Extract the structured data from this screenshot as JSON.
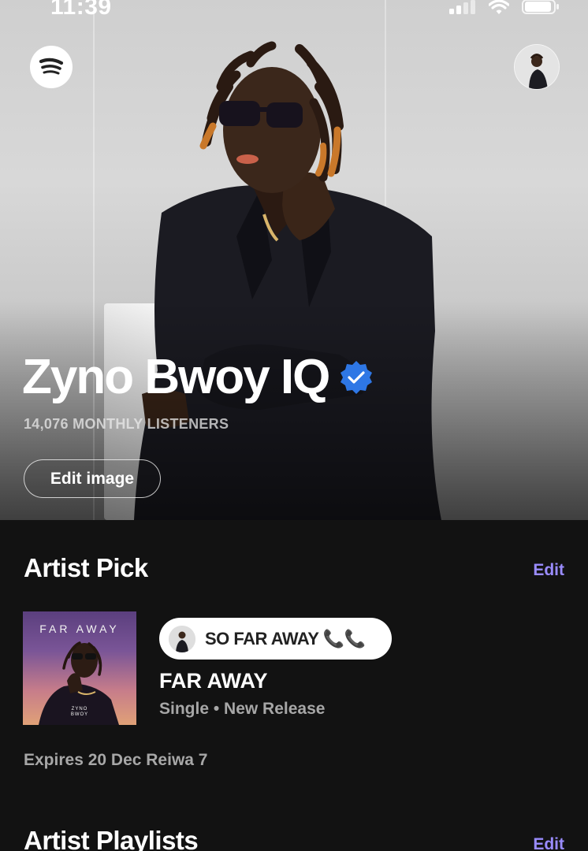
{
  "status_bar": {
    "time": "11:39",
    "icons": [
      "signal-icon",
      "wifi-icon",
      "battery-icon"
    ]
  },
  "header": {
    "logo": "spotify-logo-icon",
    "profile_avatar": "profile-avatar"
  },
  "artist": {
    "name": "Zyno Bwoy IQ",
    "verified": true,
    "monthly_listeners": "14,076 MONTHLY LISTENERS",
    "edit_image_label": "Edit image"
  },
  "artist_pick": {
    "title": "Artist Pick",
    "edit_label": "Edit",
    "cover_title": "FAR AWAY",
    "cover_subtitle_1": "ZYNO",
    "cover_subtitle_2": "BWOY",
    "pill_text": "SO FAR AWAY 📞📞",
    "release_title": "FAR AWAY",
    "release_subtitle": "Single • New Release",
    "expires": "Expires 20 Dec Reiwa 7"
  },
  "artist_playlists": {
    "title": "Artist Playlists",
    "edit_label": "Edit"
  },
  "colors": {
    "background": "#121212",
    "accent_edit": "#9a8cff",
    "verified_badge": "#2e77e5",
    "secondary_text": "#a7a7a7"
  }
}
